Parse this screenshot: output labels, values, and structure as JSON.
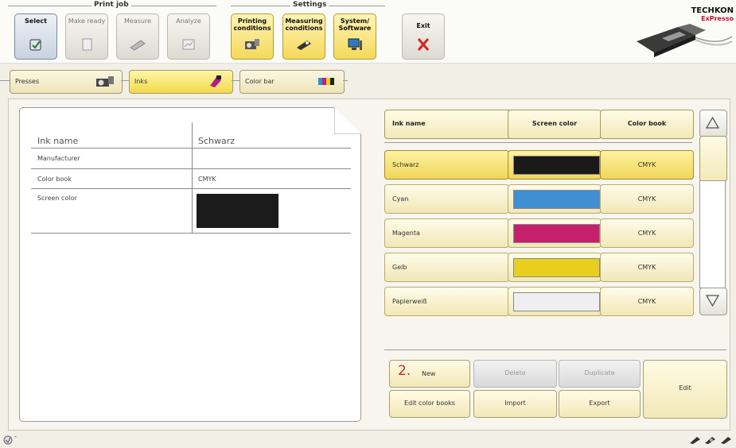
{
  "toolbar": {
    "groups": {
      "print_job": "Print job",
      "settings": "Settings"
    },
    "buttons": {
      "select": "Select",
      "make_ready": "Make ready",
      "measure": "Measure",
      "analyze": "Analyze",
      "printing_conditions": "Printing\nconditions",
      "measuring_conditions": "Measuring\nconditions",
      "system_software": "System/\nSoftware",
      "exit": "Exit"
    },
    "logo": {
      "brand": "TECHKON",
      "product": "ExPresso"
    }
  },
  "tabs": {
    "presses": "Presses",
    "inks": "Inks",
    "color_bar": "Color bar"
  },
  "detail": {
    "ink_name_label": "Ink name",
    "ink_name_value": "Schwarz",
    "manufacturer_label": "Manufacturer",
    "manufacturer_value": "",
    "color_book_label": "Color book",
    "color_book_value": "CMYK",
    "screen_color_label": "Screen color",
    "screen_color_hex": "#1b1b1b"
  },
  "ink_list": {
    "headers": {
      "ink_name": "Ink name",
      "screen_color": "Screen color",
      "color_book": "Color book"
    },
    "rows": [
      {
        "name": "Schwarz",
        "color": "#1a1a1a",
        "book": "CMYK",
        "selected": true
      },
      {
        "name": "Cyan",
        "color": "#3f8fd3",
        "book": "CMYK",
        "selected": false
      },
      {
        "name": "Magenta",
        "color": "#c51f6d",
        "book": "CMYK",
        "selected": false
      },
      {
        "name": "Gelb",
        "color": "#e8cf1e",
        "book": "CMYK",
        "selected": false
      },
      {
        "name": "Papierweiß",
        "color": "#efeff1",
        "book": "CMYK",
        "selected": false
      }
    ]
  },
  "actions": {
    "step_number": "2.",
    "new": "New",
    "delete": "Delete",
    "duplicate": "Duplicate",
    "edit": "Edit",
    "edit_color_books": "Edit color books",
    "import": "Import",
    "export": "Export"
  },
  "status": {
    "text": "-"
  },
  "colors": {
    "step_accent": "#d81e1e",
    "exit_x": "#d4261d",
    "logo_accent": "#c8102e"
  }
}
